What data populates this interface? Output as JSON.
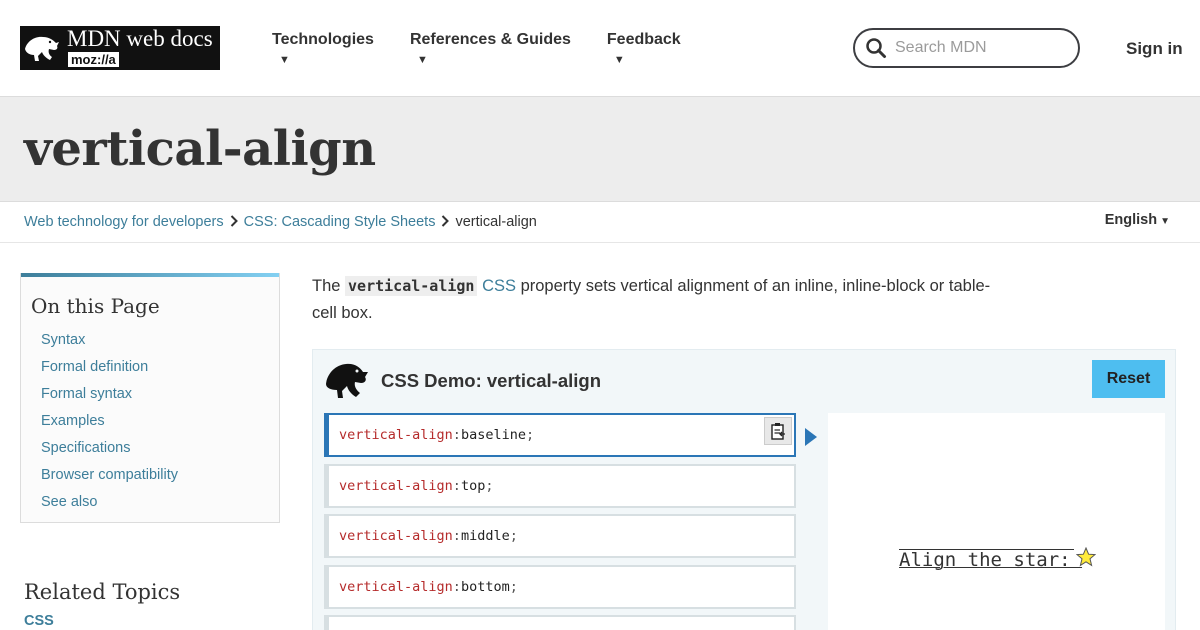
{
  "header": {
    "logo_title": "MDN web docs",
    "logo_sub": "moz://a",
    "nav": [
      {
        "label": "Technologies"
      },
      {
        "label": "References & Guides"
      },
      {
        "label": "Feedback"
      }
    ],
    "nav_caret": "▼",
    "search_placeholder": "Search MDN",
    "signin": "Sign in"
  },
  "page": {
    "title": "vertical-align"
  },
  "breadcrumb": {
    "items": [
      "Web technology for developers",
      "CSS: Cascading Style Sheets"
    ],
    "current": "vertical-align",
    "language": "English",
    "language_caret": "▼"
  },
  "toc": {
    "heading": "On this Page",
    "items": [
      "Syntax",
      "Formal definition",
      "Formal syntax",
      "Examples",
      "Specifications",
      "Browser compatibility",
      "See also"
    ]
  },
  "related": {
    "heading": "Related Topics",
    "link": "CSS"
  },
  "intro": {
    "prefix": "The ",
    "code": "vertical-align",
    "link": "CSS",
    "suffix": " property sets vertical alignment of an inline, inline-block or table-cell box."
  },
  "demo": {
    "title": "CSS Demo: vertical-align",
    "reset_label": "Reset",
    "property": "vertical-align",
    "colon": ": ",
    "semicolon": ";",
    "choices": [
      "baseline",
      "top",
      "middle",
      "bottom"
    ],
    "selected_index": 0,
    "output_text": "Align the star: ",
    "colors": {
      "accent": "#4ebef0",
      "selected_border": "#2b76b6",
      "property": "#b52b2b",
      "link": "#3d7e9a"
    }
  }
}
